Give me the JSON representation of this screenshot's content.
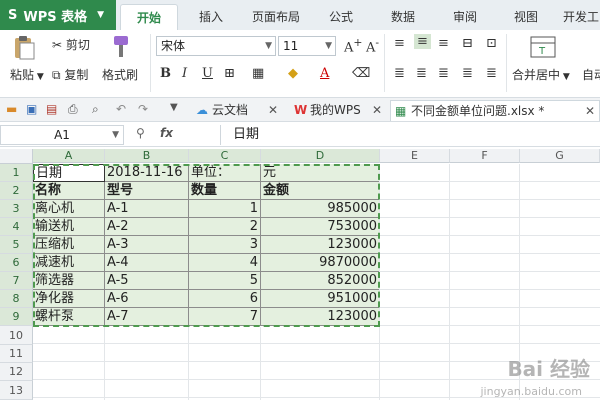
{
  "app": {
    "logo": "WPS 表格"
  },
  "ribbon_tabs": [
    "开始",
    "插入",
    "页面布局",
    "公式",
    "数据",
    "审阅",
    "视图",
    "开发工"
  ],
  "ribbon": {
    "paste": "粘贴",
    "cut": "剪切",
    "copy": "复制",
    "format_painter": "格式刷",
    "font_name": "宋体",
    "font_size": "11",
    "bold": "B",
    "italic": "I",
    "underline": "U",
    "merge_center": "合并居中",
    "auto_wrap": "自动"
  },
  "doc_tabs": [
    {
      "label": "云文档"
    },
    {
      "label": "我的WPS"
    },
    {
      "label": "不同金额单位问题.xlsx *"
    }
  ],
  "formula": {
    "name_box": "A1",
    "fx": "fx",
    "content": "日期"
  },
  "sheet": {
    "columns": [
      "A",
      "B",
      "C",
      "D",
      "E",
      "F",
      "G"
    ],
    "rows": [
      "1",
      "2",
      "3",
      "4",
      "5",
      "6",
      "7",
      "8",
      "9",
      "10",
      "11",
      "12",
      "13"
    ],
    "row1": {
      "a": "日期",
      "b": "2018-11-16",
      "c": "单位：",
      "d": "元"
    },
    "header": {
      "a": "名称",
      "b": "型号",
      "c": "数量",
      "d": "金额"
    },
    "data": [
      {
        "name": "离心机",
        "model": "A-1",
        "qty": "1",
        "amount": "985000"
      },
      {
        "name": "输送机",
        "model": "A-2",
        "qty": "2",
        "amount": "753000"
      },
      {
        "name": "压缩机",
        "model": "A-3",
        "qty": "3",
        "amount": "123000"
      },
      {
        "name": "减速机",
        "model": "A-4",
        "qty": "4",
        "amount": "9870000"
      },
      {
        "name": "筛选器",
        "model": "A-5",
        "qty": "5",
        "amount": "852000"
      },
      {
        "name": "净化器",
        "model": "A-6",
        "qty": "6",
        "amount": "951000"
      },
      {
        "name": "螺杆泵",
        "model": "A-7",
        "qty": "7",
        "amount": "123000"
      }
    ]
  },
  "watermark": {
    "main": "Bai 经验",
    "sub": "jingyan.baidu.com"
  },
  "colors": {
    "brand": "#2f8a4c",
    "selection": "#e4f0df"
  }
}
